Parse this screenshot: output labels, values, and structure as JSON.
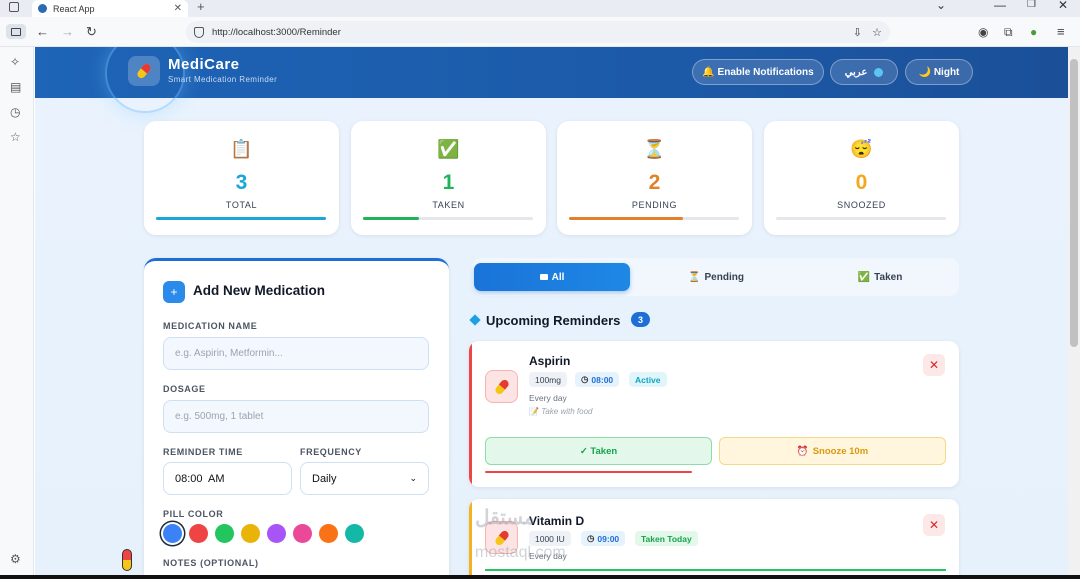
{
  "browser": {
    "tab_title": "React App",
    "url": "http://localhost:3000/Reminder"
  },
  "header": {
    "brand": "MediCare",
    "tagline": "Smart Medication Reminder",
    "notifications_label": "🔔 Enable Notifications",
    "language_label": "عربي",
    "theme_label": "🌙 Night"
  },
  "stats": [
    {
      "icon": "📋",
      "value": "3",
      "label": "TOTAL",
      "color": "#1aa6d8",
      "progress": 1.0
    },
    {
      "icon": "✅",
      "value": "1",
      "label": "TAKEN",
      "color": "#22b35a",
      "progress": 0.33
    },
    {
      "icon": "⏳",
      "value": "2",
      "label": "PENDING",
      "color": "#e0822a",
      "progress": 0.67
    },
    {
      "icon": "😴",
      "value": "0",
      "label": "SNOOZED",
      "color": "#f2a81d",
      "progress": 0
    }
  ],
  "form": {
    "title": "Add New Medication",
    "name_label": "MEDICATION NAME",
    "name_placeholder": "e.g. Aspirin, Metformin...",
    "dosage_label": "DOSAGE",
    "dosage_placeholder": "e.g. 500mg, 1 tablet",
    "time_label": "REMINDER TIME",
    "time_value": "08:00  AM",
    "frequency_label": "FREQUENCY",
    "frequency_value": "Daily",
    "color_label": "PILL COLOR",
    "colors": [
      "#3b82f6",
      "#ef4444",
      "#22c55e",
      "#eab308",
      "#a855f7",
      "#ec4899",
      "#f97316",
      "#14b8a6"
    ],
    "notes_label": "NOTES (OPTIONAL)"
  },
  "filters": {
    "all": "All",
    "pending": "Pending",
    "taken": "Taken"
  },
  "section": {
    "title": "Upcoming Reminders",
    "count": "3"
  },
  "reminders": [
    {
      "name": "Aspirin",
      "dosage": "100mg",
      "time": "08:00",
      "status": "Active",
      "frequency": "Every day",
      "note": "Take with food",
      "taken_label": "✓ Taken",
      "snooze_label": "Snooze 10m"
    },
    {
      "name": "Vitamin D",
      "dosage": "1000 IU",
      "time": "09:00",
      "status": "Taken Today",
      "frequency": "Every day"
    }
  ],
  "watermark": "مستقل",
  "watermark_sub": "mostaql.com"
}
